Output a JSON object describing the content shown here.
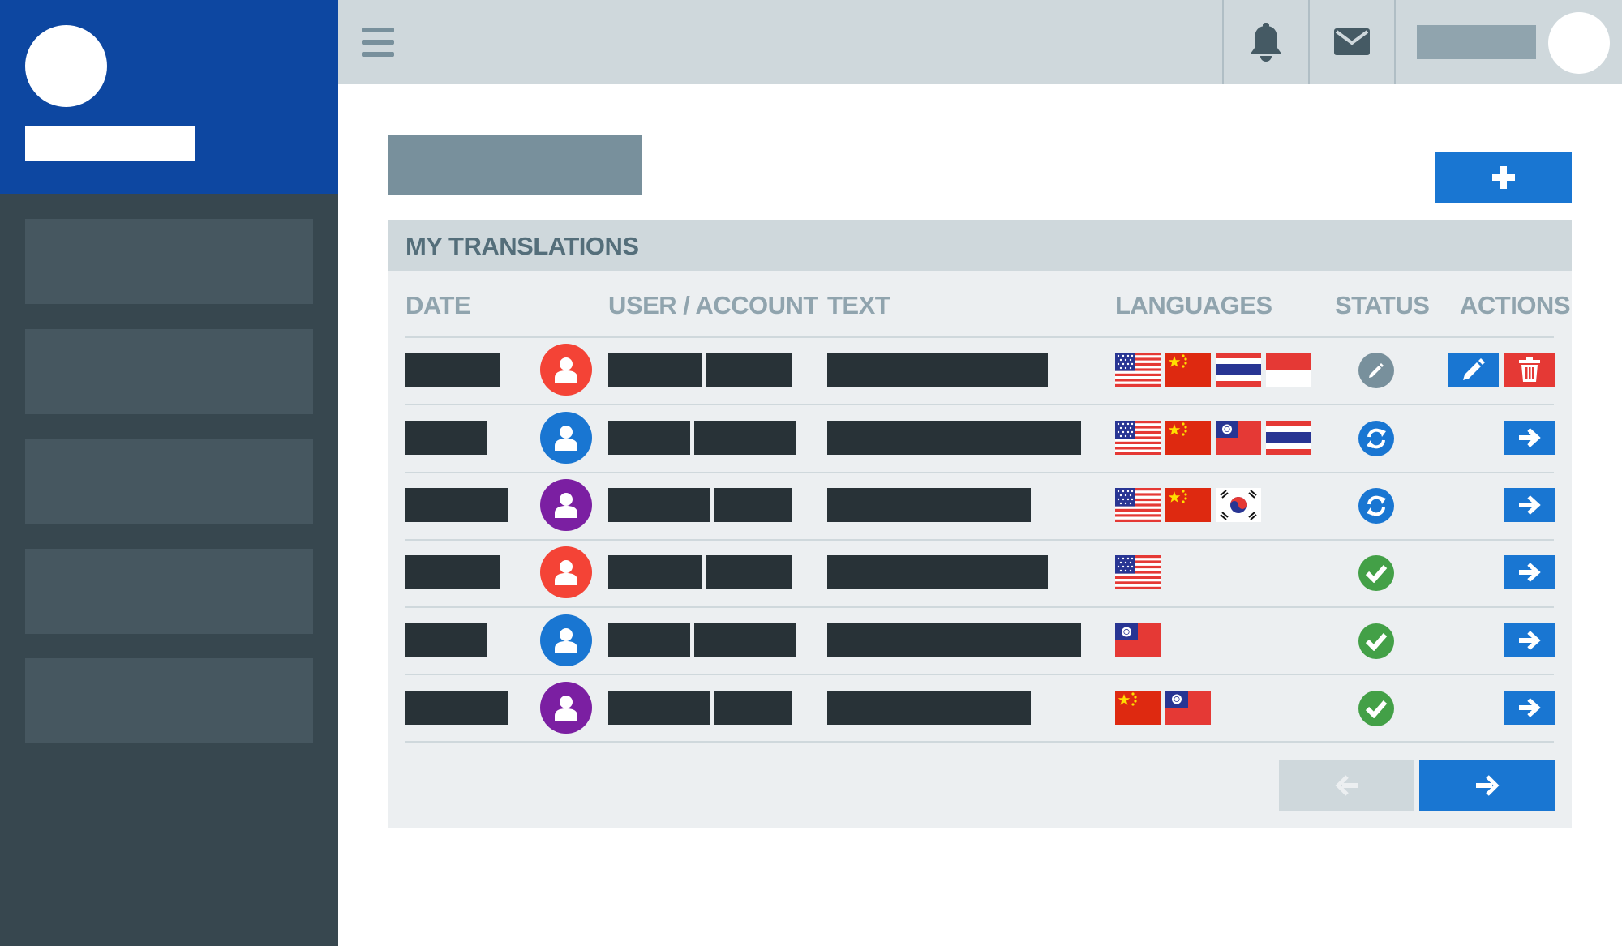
{
  "colors": {
    "brand_blue": "#0d47a1",
    "sidebar_dark": "#37474f",
    "topbar": "#cfd8dc",
    "panel": "#eceff1",
    "primary": "#1976d2",
    "danger": "#e53935",
    "success": "#43a047",
    "avatar_red": "#f44336",
    "avatar_blue": "#1976d2",
    "avatar_purple": "#7b1fa2"
  },
  "topbar": {
    "menu_icon": "hamburger-icon",
    "notification_icon": "bell-icon",
    "messages_icon": "envelope-icon"
  },
  "panel": {
    "title": "MY TRANSLATIONS",
    "columns": {
      "date": "DATE",
      "user": "USER / ACCOUNT",
      "text": "TEXT",
      "languages": "LANGUAGES",
      "status": "STATUS",
      "actions": "ACTIONS"
    }
  },
  "rows": [
    {
      "avatar_color": "#f44336",
      "languages": [
        "us",
        "cn",
        "th",
        "id"
      ],
      "status": "editing",
      "actions": [
        "edit",
        "delete"
      ]
    },
    {
      "avatar_color": "#1976d2",
      "languages": [
        "us",
        "cn",
        "tw",
        "th"
      ],
      "status": "in-progress",
      "actions": [
        "open"
      ]
    },
    {
      "avatar_color": "#7b1fa2",
      "languages": [
        "us",
        "cn",
        "kr"
      ],
      "status": "in-progress",
      "actions": [
        "open"
      ]
    },
    {
      "avatar_color": "#f44336",
      "languages": [
        "us"
      ],
      "status": "done",
      "actions": [
        "open"
      ]
    },
    {
      "avatar_color": "#1976d2",
      "languages": [
        "tw"
      ],
      "status": "done",
      "actions": [
        "open"
      ]
    },
    {
      "avatar_color": "#7b1fa2",
      "languages": [
        "cn",
        "tw"
      ],
      "status": "done",
      "actions": [
        "open"
      ]
    }
  ],
  "pagination": {
    "prev_enabled": false,
    "next_enabled": true
  }
}
